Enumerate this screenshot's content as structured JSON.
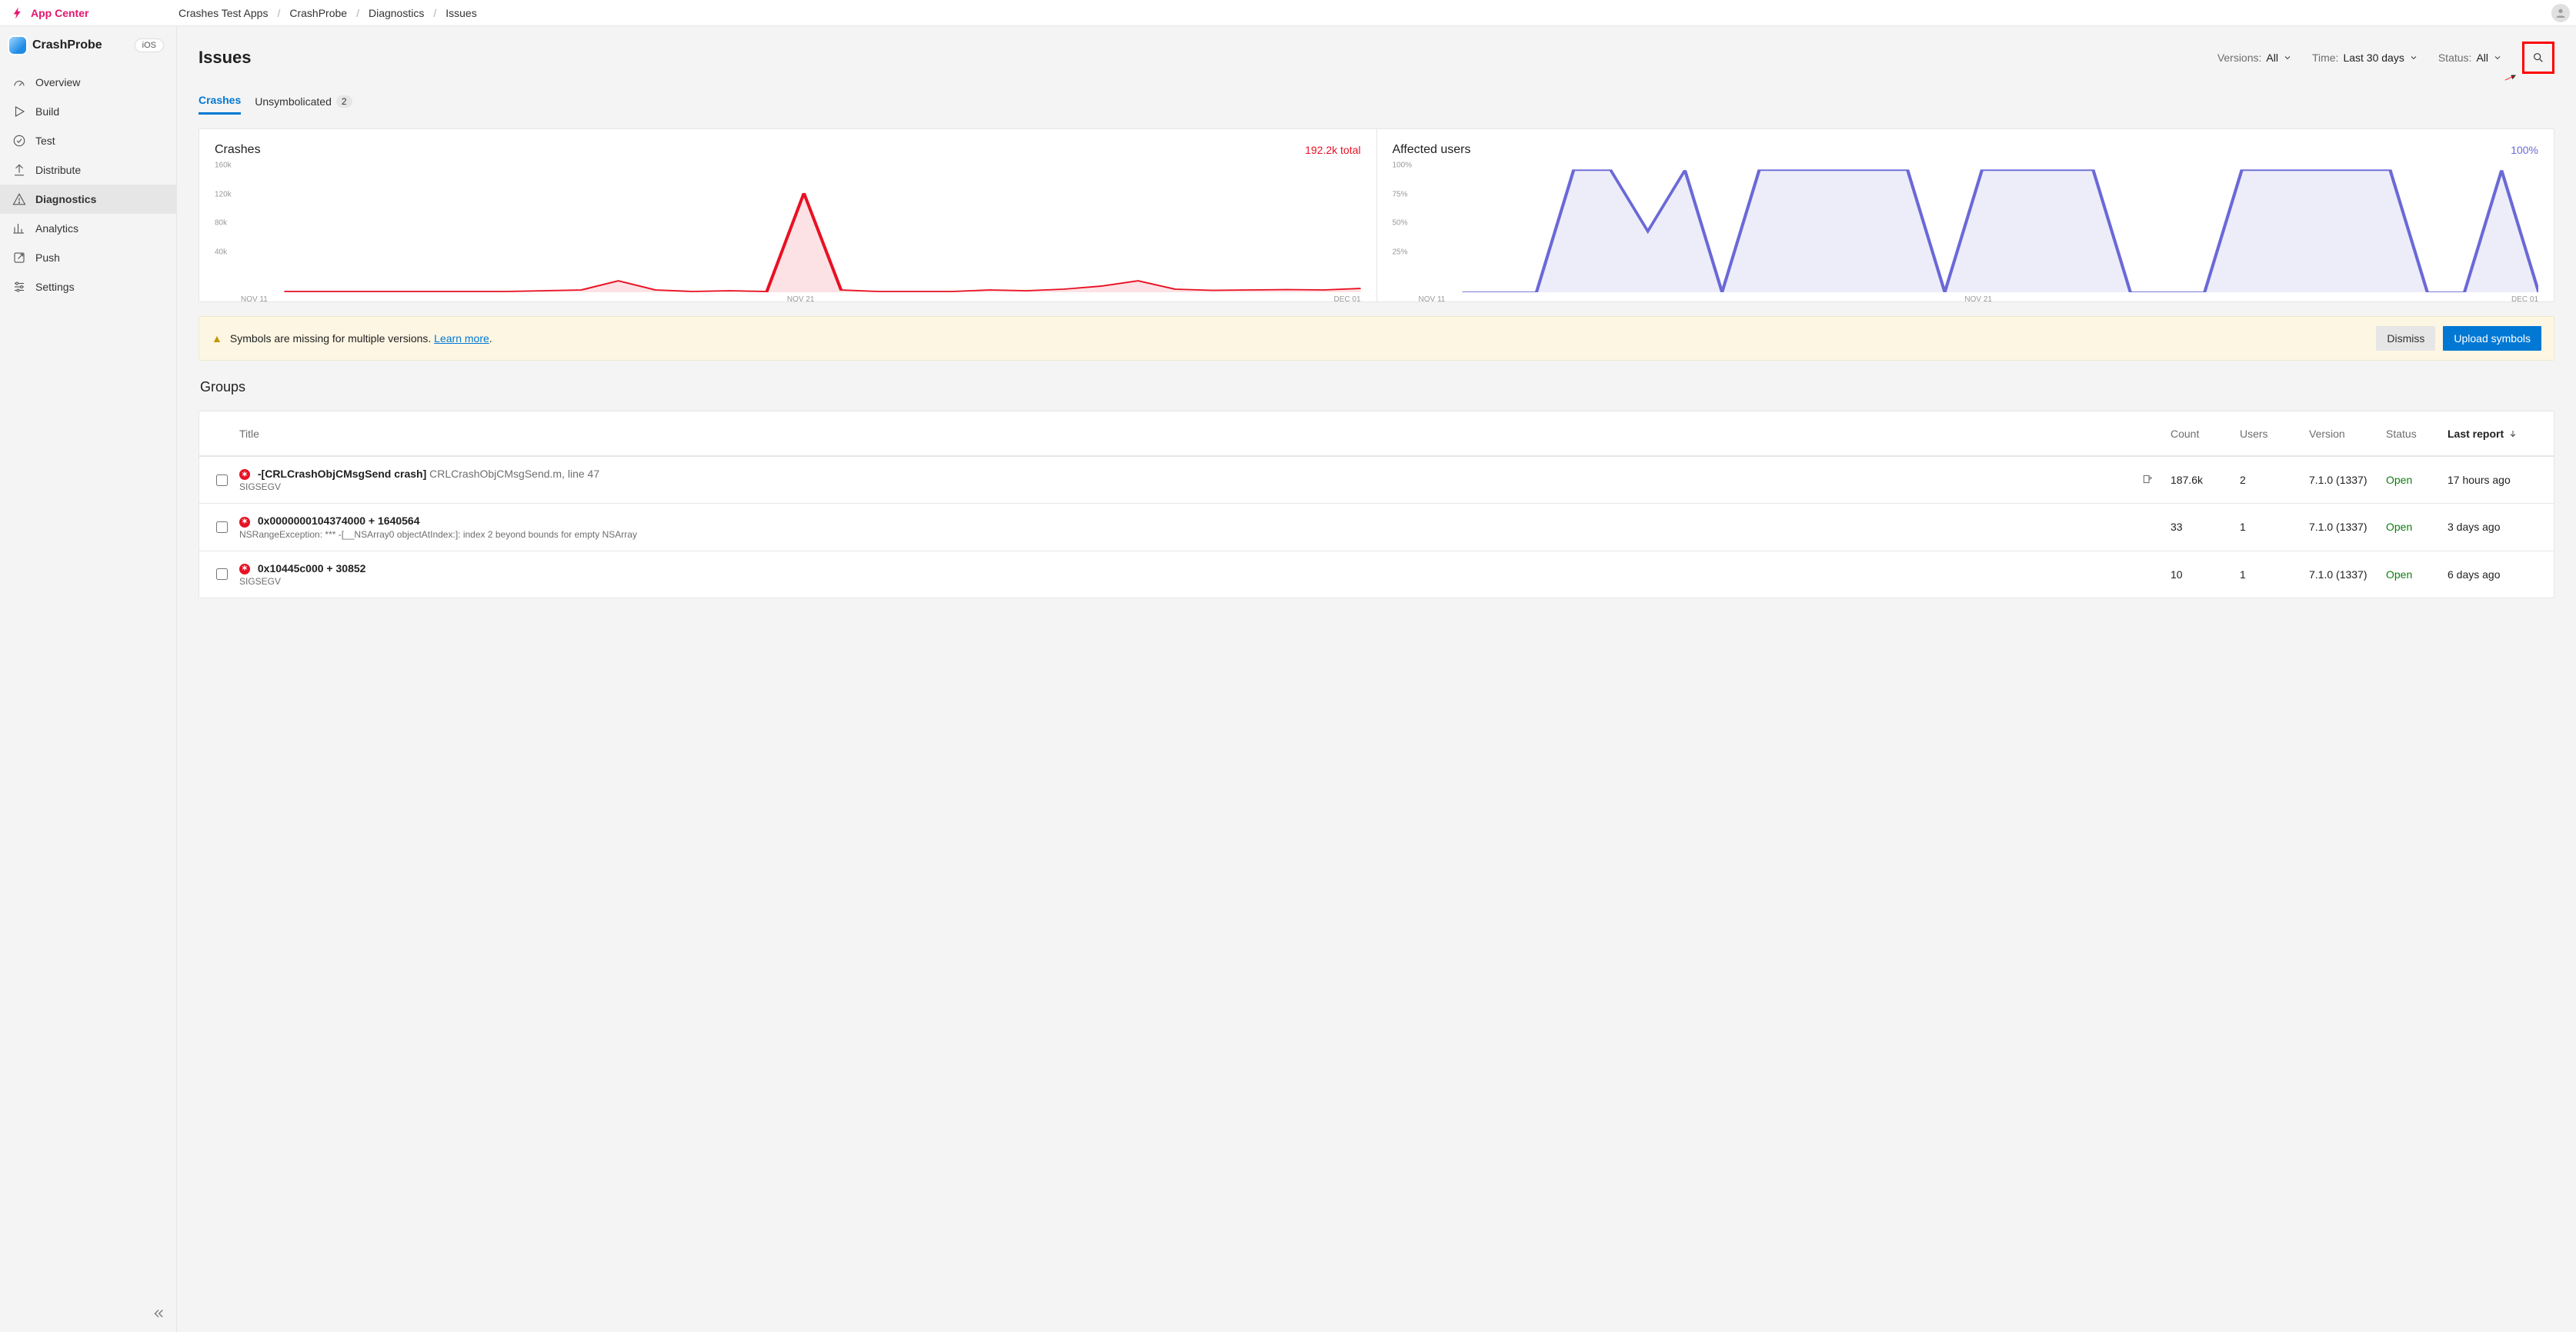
{
  "brand": "App Center",
  "breadcrumbs": [
    "Crashes Test Apps",
    "CrashProbe",
    "Diagnostics",
    "Issues"
  ],
  "app": {
    "name": "CrashProbe",
    "platform": "iOS"
  },
  "sidebar": {
    "items": [
      {
        "id": "overview",
        "label": "Overview"
      },
      {
        "id": "build",
        "label": "Build"
      },
      {
        "id": "test",
        "label": "Test"
      },
      {
        "id": "distribute",
        "label": "Distribute"
      },
      {
        "id": "diagnostics",
        "label": "Diagnostics"
      },
      {
        "id": "analytics",
        "label": "Analytics"
      },
      {
        "id": "push",
        "label": "Push"
      },
      {
        "id": "settings",
        "label": "Settings"
      }
    ],
    "active": "diagnostics"
  },
  "page_title": "Issues",
  "filters": {
    "versions": {
      "label": "Versions:",
      "value": "All"
    },
    "time": {
      "label": "Time:",
      "value": "Last 30 days"
    },
    "status": {
      "label": "Status:",
      "value": "All"
    }
  },
  "tabs": [
    {
      "id": "crashes",
      "label": "Crashes",
      "active": true
    },
    {
      "id": "unsymbolicated",
      "label": "Unsymbolicated",
      "active": false,
      "badge": "2"
    }
  ],
  "banner": {
    "text": "Symbols are missing for multiple versions.",
    "link_text": "Learn more",
    "dismiss": "Dismiss",
    "upload": "Upload symbols"
  },
  "groups_section_title": "Groups",
  "table": {
    "headers": {
      "title": "Title",
      "count": "Count",
      "users": "Users",
      "version": "Version",
      "status": "Status",
      "last_report": "Last report"
    },
    "rows": [
      {
        "title_main": "-[CRLCrashObjCMsgSend crash]",
        "title_sub": "CRLCrashObjCMsgSend.m, line 47",
        "subtext": "SIGSEGV",
        "count": "187.6k",
        "users": "2",
        "version": "7.1.0 (1337)",
        "status": "Open",
        "last_report": "17 hours ago",
        "editable": true
      },
      {
        "title_main": "0x0000000104374000 + 1640564",
        "title_sub": "",
        "subtext": "NSRangeException: *** -[__NSArray0 objectAtIndex:]: index 2 beyond bounds for empty NSArray",
        "count": "33",
        "users": "1",
        "version": "7.1.0 (1337)",
        "status": "Open",
        "last_report": "3 days ago",
        "editable": false
      },
      {
        "title_main": "0x10445c000 + 30852",
        "title_sub": "",
        "subtext": "SIGSEGV",
        "count": "10",
        "users": "1",
        "version": "7.1.0 (1337)",
        "status": "Open",
        "last_report": "6 days ago",
        "editable": false
      }
    ]
  },
  "chart_data": [
    {
      "type": "area",
      "title": "Crashes",
      "total_label": "192.2k total",
      "color": "#e81123",
      "yticks": [
        "160k",
        "120k",
        "80k",
        "40k"
      ],
      "xticks": [
        "NOV 11",
        "NOV 21",
        "DEC 01"
      ],
      "ylim": [
        0,
        160000
      ],
      "x": [
        0,
        1,
        2,
        3,
        4,
        5,
        6,
        7,
        8,
        9,
        10,
        11,
        12,
        13,
        14,
        15,
        16,
        17,
        18,
        19,
        20,
        21,
        22,
        23,
        24,
        25,
        26,
        27,
        28,
        29
      ],
      "values": [
        1000,
        1000,
        1000,
        1000,
        1000,
        1000,
        1000,
        2000,
        3000,
        15000,
        3000,
        1000,
        2000,
        1000,
        130000,
        3000,
        1000,
        1000,
        1000,
        3000,
        2000,
        4000,
        8000,
        15000,
        4000,
        2500,
        3000,
        3500,
        3000,
        5000
      ]
    },
    {
      "type": "area",
      "title": "Affected users",
      "total_label": "100%",
      "color": "#6b69d6",
      "yticks": [
        "100%",
        "75%",
        "50%",
        "25%"
      ],
      "xticks": [
        "NOV 11",
        "NOV 21",
        "DEC 01"
      ],
      "ylim": [
        0,
        100
      ],
      "x": [
        0,
        1,
        2,
        3,
        4,
        5,
        6,
        7,
        8,
        9,
        10,
        11,
        12,
        13,
        14,
        15,
        16,
        17,
        18,
        19,
        20,
        21,
        22,
        23,
        24,
        25,
        26,
        27,
        28,
        29
      ],
      "values": [
        0,
        0,
        0,
        100,
        100,
        50,
        100,
        0,
        100,
        100,
        100,
        100,
        100,
        0,
        100,
        100,
        100,
        100,
        0,
        0,
        0,
        100,
        100,
        100,
        100,
        100,
        0,
        0,
        100,
        0
      ]
    }
  ]
}
